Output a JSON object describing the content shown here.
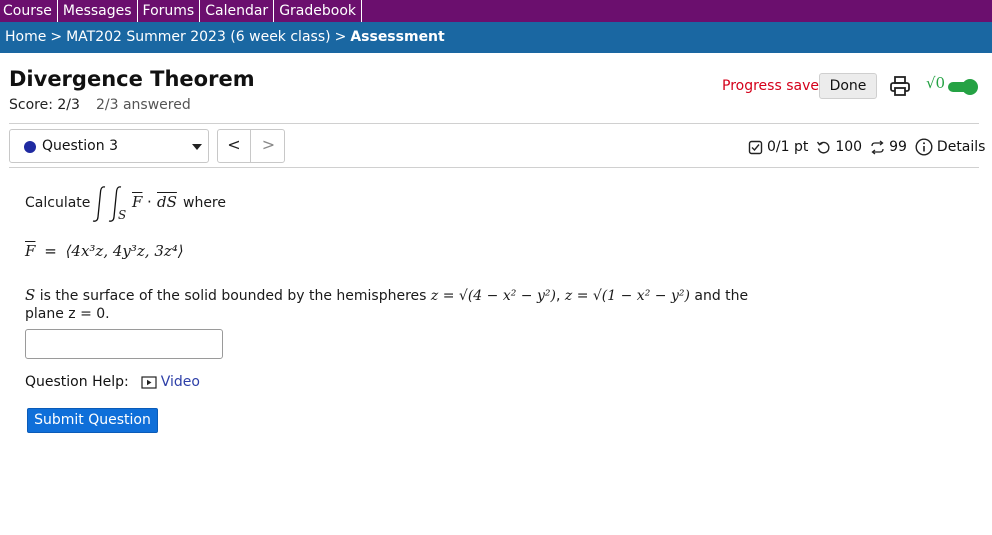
{
  "topnav": {
    "items": [
      "Course",
      "Messages",
      "Forums",
      "Calendar",
      "Gradebook"
    ]
  },
  "breadcrumb": {
    "home": "Home",
    "course": "MAT202 Summer 2023 (6 week class)",
    "current": "Assessment",
    "separator": ">"
  },
  "header": {
    "title": "Divergence Theorem",
    "score": "Score: 2/3",
    "answered": "2/3 answered",
    "progress_saved": "Progress saved",
    "done_label": "Done",
    "sqrt_label": "√0"
  },
  "question_nav": {
    "selected": "Question 3",
    "prev": "<",
    "next": ">"
  },
  "stats": {
    "points": "0/1 pt",
    "retries": "100",
    "attempts": "99",
    "details": "Details"
  },
  "question": {
    "calc_prefix": "Calculate",
    "calc_suffix": "where",
    "integral_sub": "S",
    "integrand_F": "F",
    "integrand_dot": "·",
    "integrand_dS": "dS",
    "field_lhs": "F",
    "field_eq": "=",
    "field_vector": "⟨4x³z, 4y³z, 3z⁴⟩",
    "surface_S": "S",
    "surface_text": "is the surface of the solid bounded by the hemispheres",
    "hemi1": "z = √(4 − x² − y²)",
    "comma": ",",
    "hemi2": "z = √(1 − x² − y²)",
    "and_the": "and the",
    "plane_text": "plane z = 0.",
    "answer_value": "",
    "help_label": "Question Help:",
    "video_label": "Video",
    "submit_label": "Submit Question"
  },
  "colors": {
    "nav_bg": "#6b0f6e",
    "crumb_bg": "#1a67a2",
    "progress_red": "#d4001a",
    "toggle_green": "#25a244",
    "submit_blue": "#0f6fd9",
    "question_dot": "#1f2aa1"
  },
  "icons": [
    "print-icon",
    "checkbox-icon",
    "retry-icon",
    "attempts-icon",
    "info-icon",
    "video-icon",
    "chevron-down-icon"
  ]
}
